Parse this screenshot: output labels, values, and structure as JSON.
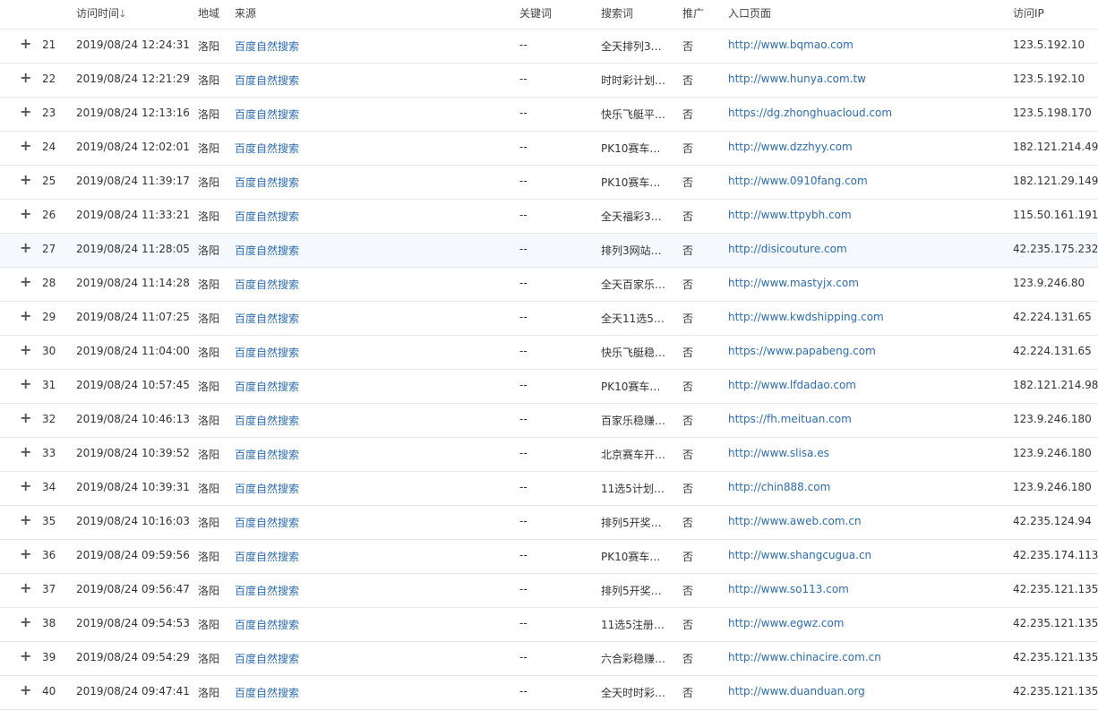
{
  "headers": {
    "time": "访问时间",
    "region": "地域",
    "source": "来源",
    "keyword": "关键词",
    "search": "搜索词",
    "promo": "推广",
    "entry": "入口页面",
    "ip": "访问IP"
  },
  "sort_icon": "arrow-down-icon",
  "rows": [
    {
      "idx": "21",
      "time": "2019/08/24 12:24:31",
      "region": "洛阳",
      "source": "百度自然搜索",
      "keyword": "--",
      "search": "全天排列3…",
      "promo": "否",
      "entry": "http://www.bqmao.com",
      "ip": "123.5.192.10"
    },
    {
      "idx": "22",
      "time": "2019/08/24 12:21:29",
      "region": "洛阳",
      "source": "百度自然搜索",
      "keyword": "--",
      "search": "时时彩计划…",
      "promo": "否",
      "entry": "http://www.hunya.com.tw",
      "ip": "123.5.192.10"
    },
    {
      "idx": "23",
      "time": "2019/08/24 12:13:16",
      "region": "洛阳",
      "source": "百度自然搜索",
      "keyword": "--",
      "search": "快乐飞艇平…",
      "promo": "否",
      "entry": "https://dg.zhonghuacloud.com",
      "ip": "123.5.198.170"
    },
    {
      "idx": "24",
      "time": "2019/08/24 12:02:01",
      "region": "洛阳",
      "source": "百度自然搜索",
      "keyword": "--",
      "search": "PK10赛车…",
      "promo": "否",
      "entry": "http://www.dzzhyy.com",
      "ip": "182.121.214.49"
    },
    {
      "idx": "25",
      "time": "2019/08/24 11:39:17",
      "region": "洛阳",
      "source": "百度自然搜索",
      "keyword": "--",
      "search": "PK10赛车…",
      "promo": "否",
      "entry": "http://www.0910fang.com",
      "ip": "182.121.29.149"
    },
    {
      "idx": "26",
      "time": "2019/08/24 11:33:21",
      "region": "洛阳",
      "source": "百度自然搜索",
      "keyword": "--",
      "search": "全天福彩3…",
      "promo": "否",
      "entry": "http://www.ttpybh.com",
      "ip": "115.50.161.191"
    },
    {
      "idx": "27",
      "time": "2019/08/24 11:28:05",
      "region": "洛阳",
      "source": "百度自然搜索",
      "keyword": "--",
      "search": "排列3网站…",
      "promo": "否",
      "entry": "http://disicouture.com",
      "ip": "42.235.175.232"
    },
    {
      "idx": "28",
      "time": "2019/08/24 11:14:28",
      "region": "洛阳",
      "source": "百度自然搜索",
      "keyword": "--",
      "search": "全天百家乐…",
      "promo": "否",
      "entry": "http://www.mastyjx.com",
      "ip": "123.9.246.80"
    },
    {
      "idx": "29",
      "time": "2019/08/24 11:07:25",
      "region": "洛阳",
      "source": "百度自然搜索",
      "keyword": "--",
      "search": "全天11选5…",
      "promo": "否",
      "entry": "http://www.kwdshipping.com",
      "ip": "42.224.131.65"
    },
    {
      "idx": "30",
      "time": "2019/08/24 11:04:00",
      "region": "洛阳",
      "source": "百度自然搜索",
      "keyword": "--",
      "search": "快乐飞艇稳…",
      "promo": "否",
      "entry": "https://www.papabeng.com",
      "ip": "42.224.131.65"
    },
    {
      "idx": "31",
      "time": "2019/08/24 10:57:45",
      "region": "洛阳",
      "source": "百度自然搜索",
      "keyword": "--",
      "search": "PK10赛车…",
      "promo": "否",
      "entry": "http://www.lfdadao.com",
      "ip": "182.121.214.98"
    },
    {
      "idx": "32",
      "time": "2019/08/24 10:46:13",
      "region": "洛阳",
      "source": "百度自然搜索",
      "keyword": "--",
      "search": "百家乐稳赚…",
      "promo": "否",
      "entry": "https://fh.meituan.com",
      "ip": "123.9.246.180"
    },
    {
      "idx": "33",
      "time": "2019/08/24 10:39:52",
      "region": "洛阳",
      "source": "百度自然搜索",
      "keyword": "--",
      "search": "北京赛车开…",
      "promo": "否",
      "entry": "http://www.slisa.es",
      "ip": "123.9.246.180"
    },
    {
      "idx": "34",
      "time": "2019/08/24 10:39:31",
      "region": "洛阳",
      "source": "百度自然搜索",
      "keyword": "--",
      "search": "11选5计划…",
      "promo": "否",
      "entry": "http://chin888.com",
      "ip": "123.9.246.180"
    },
    {
      "idx": "35",
      "time": "2019/08/24 10:16:03",
      "region": "洛阳",
      "source": "百度自然搜索",
      "keyword": "--",
      "search": "排列5开奖…",
      "promo": "否",
      "entry": "http://www.aweb.com.cn",
      "ip": "42.235.124.94"
    },
    {
      "idx": "36",
      "time": "2019/08/24 09:59:56",
      "region": "洛阳",
      "source": "百度自然搜索",
      "keyword": "--",
      "search": "PK10赛车…",
      "promo": "否",
      "entry": "http://www.shangcugua.cn",
      "ip": "42.235.174.113"
    },
    {
      "idx": "37",
      "time": "2019/08/24 09:56:47",
      "region": "洛阳",
      "source": "百度自然搜索",
      "keyword": "--",
      "search": "排列5开奖…",
      "promo": "否",
      "entry": "http://www.so113.com",
      "ip": "42.235.121.135"
    },
    {
      "idx": "38",
      "time": "2019/08/24 09:54:53",
      "region": "洛阳",
      "source": "百度自然搜索",
      "keyword": "--",
      "search": "11选5注册…",
      "promo": "否",
      "entry": "http://www.egwz.com",
      "ip": "42.235.121.135"
    },
    {
      "idx": "39",
      "time": "2019/08/24 09:54:29",
      "region": "洛阳",
      "source": "百度自然搜索",
      "keyword": "--",
      "search": "六合彩稳赚…",
      "promo": "否",
      "entry": "http://www.chinacire.com.cn",
      "ip": "42.235.121.135"
    },
    {
      "idx": "40",
      "time": "2019/08/24 09:47:41",
      "region": "洛阳",
      "source": "百度自然搜索",
      "keyword": "--",
      "search": "全天时时彩…",
      "promo": "否",
      "entry": "http://www.duanduan.org",
      "ip": "42.235.121.135"
    }
  ],
  "highlighted_row": "27",
  "colors": {
    "link": "#2b6cb0",
    "border": "#e6e6e6",
    "highlight": "#f5f8fd"
  }
}
